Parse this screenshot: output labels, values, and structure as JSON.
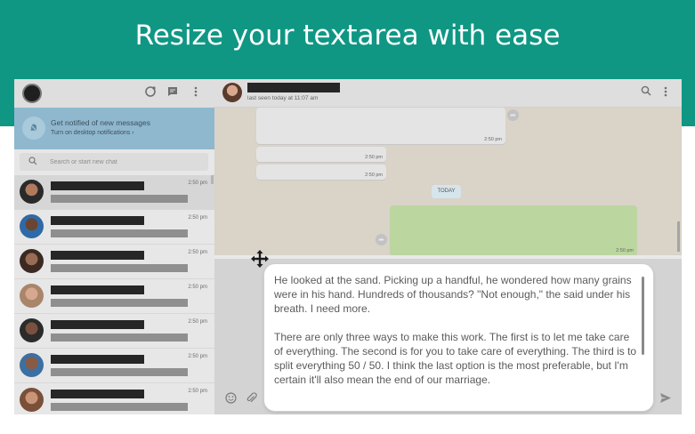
{
  "banner": {
    "title": "Resize your textarea with ease",
    "color": "#0f9784"
  },
  "sidebar": {
    "header_icons": [
      "refresh-icon",
      "chat-icon",
      "menu-icon"
    ],
    "notification": {
      "title": "Get notified of new messages",
      "subtitle": "Turn on desktop notifications ›"
    },
    "search": {
      "placeholder": "Search or start new chat"
    },
    "chats": [
      {
        "time": "2:50 pm",
        "active": true
      },
      {
        "time": "2:50 pm"
      },
      {
        "time": "2:50 pm"
      },
      {
        "time": "2:50 pm"
      },
      {
        "time": "2:50 pm"
      },
      {
        "time": "2:50 pm"
      },
      {
        "time": "2:50 pm"
      }
    ]
  },
  "conversation": {
    "status": "last seen today at 11:07 am",
    "bubbles": [
      {
        "time": "2:50 pm"
      },
      {
        "time": "2:50 pm"
      },
      {
        "time": "2:50 pm"
      },
      {
        "time": "2:50 pm"
      }
    ],
    "date_divider": "TODAY"
  },
  "editor": {
    "text": "He looked at the sand. Picking up a handful, he wondered how many grains were in his hand. Hundreds of thousands? \"Not enough,\" the said under his breath. I need more.\n\nThere are only three ways to make this work. The first is to let me take care of everything. The second is for you to take care of everything. The third is to split everything 50 / 50. I think the last option is the most preferable, but I'm certain it'll also mean the end of our marriage."
  }
}
